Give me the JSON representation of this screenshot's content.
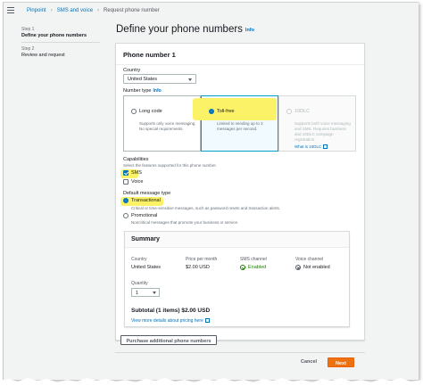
{
  "breadcrumb": {
    "items": [
      "Pinpoint",
      "SMS and voice"
    ],
    "current": "Request phone number"
  },
  "steps": [
    {
      "label": "Step 1",
      "name": "Define your phone numbers"
    },
    {
      "label": "Step 2",
      "name": "Review and request"
    }
  ],
  "page": {
    "title": "Define your phone numbers",
    "info": "Info"
  },
  "panel": {
    "title": "Phone number 1",
    "country_label": "Country",
    "country_value": "United States",
    "number_type_label": "Number type",
    "number_type_info": "Info",
    "tiles": [
      {
        "title": "Long code",
        "desc": "Supports only voice messaging. No special requirements."
      },
      {
        "title": "Toll-free",
        "desc": "Limited to sending up to 3 messages per second."
      },
      {
        "title": "10DLC",
        "desc": "Supports both voice messaging and SMS. Requires business and 10DLC campaign registration.",
        "link": "What is 10DLC"
      }
    ],
    "capabilities_label": "Capabilities",
    "capabilities_desc": "Select the features supported for this phone number.",
    "cap_sms": "SMS",
    "cap_voice": "Voice",
    "msg_type_label": "Default message type",
    "transactional": "Transactional",
    "transactional_desc": "Critical or time-sensitive messages, such as password resets and transaction alerts.",
    "promotional": "Promotional",
    "promotional_desc": "Noncritical messages that promote your business or service."
  },
  "summary": {
    "title": "Summary",
    "headers": [
      "Country",
      "Price per month",
      "SMS channel",
      "Voice channel"
    ],
    "values": [
      "United States",
      "$2.00 USD",
      "Enabled",
      "Not enabled"
    ],
    "quantity_label": "Quantity",
    "quantity_value": "1",
    "subtotal": "Subtotal (1 items) $2.00 USD",
    "more_link": "View more details about pricing here"
  },
  "buttons": {
    "purchase": "Purchase additional phone numbers",
    "cancel": "Cancel",
    "next": "Next"
  },
  "colors": {
    "link": "#0073bb",
    "primary": "#ec7211",
    "highlight": "#fbf267",
    "selected_border": "#00a1c9",
    "ok": "#1d8102"
  }
}
